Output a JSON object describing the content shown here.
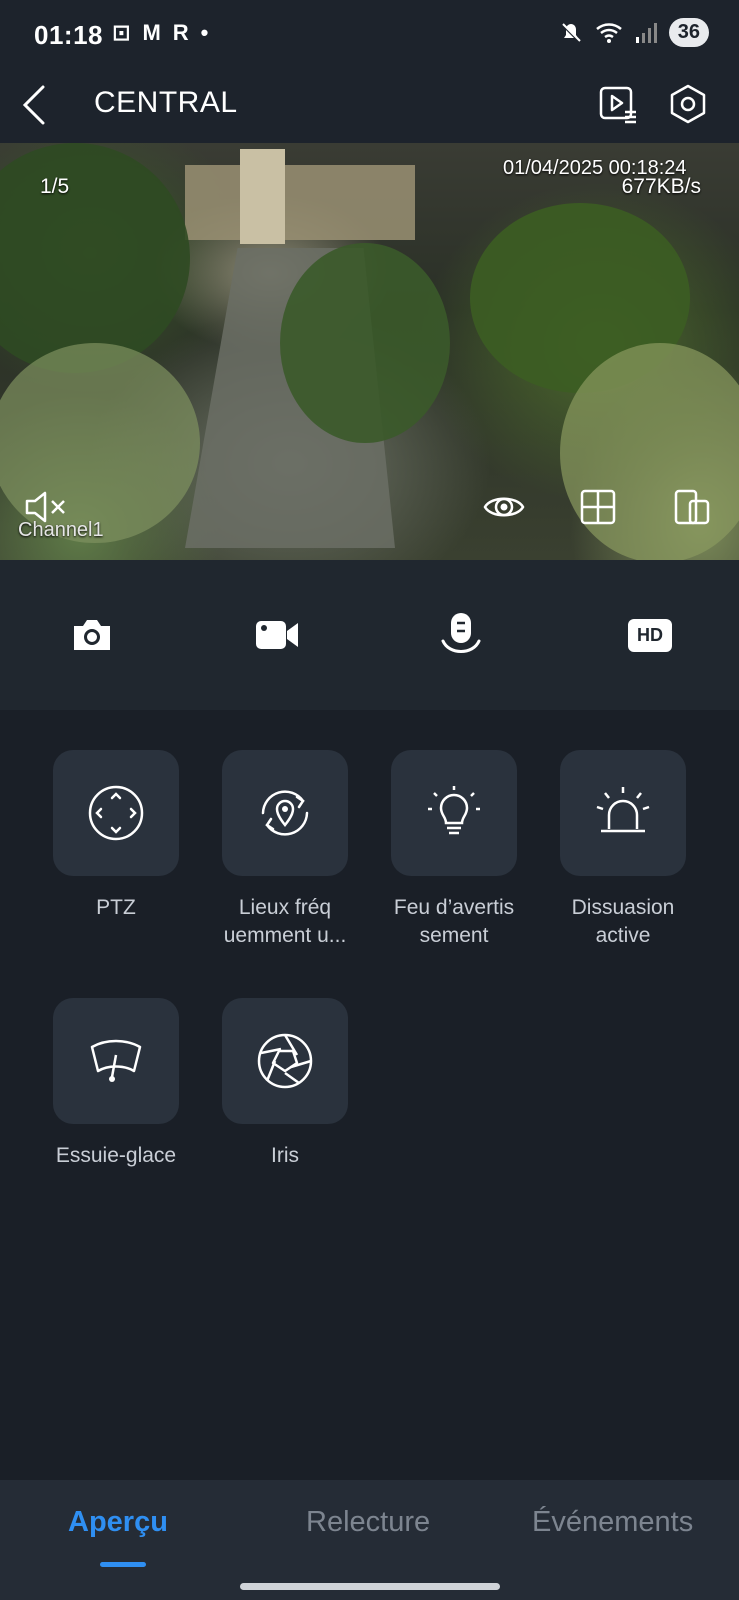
{
  "status_bar": {
    "time": "01:18",
    "apps": [
      "⊡",
      "M",
      "R",
      "•"
    ],
    "battery": "36"
  },
  "header": {
    "title": "CENTRAL"
  },
  "video": {
    "page_indicator": "1/5",
    "datetime": "01/04/2025 00:18:24",
    "bitrate": "677KB/s",
    "channel": "Channel1"
  },
  "toolbar": {
    "hd_label": "HD"
  },
  "tiles": [
    {
      "label": "PTZ",
      "icon": "ptz-icon"
    },
    {
      "label": "Lieux fréq uemment u...",
      "icon": "location-refresh-icon"
    },
    {
      "label": "Feu d’avertis sement",
      "icon": "warning-light-icon"
    },
    {
      "label": "Dissuasion active",
      "icon": "siren-icon"
    },
    {
      "label": "Essuie-glace",
      "icon": "wiper-icon"
    },
    {
      "label": "Iris",
      "icon": "iris-icon"
    }
  ],
  "bottom_nav": {
    "items": [
      "Aperçu",
      "Relecture",
      "Événements"
    ],
    "active": "Aperçu"
  },
  "colors": {
    "accent": "#2f8ff2",
    "background": "#1a1f27",
    "tile": "#2a323d"
  }
}
